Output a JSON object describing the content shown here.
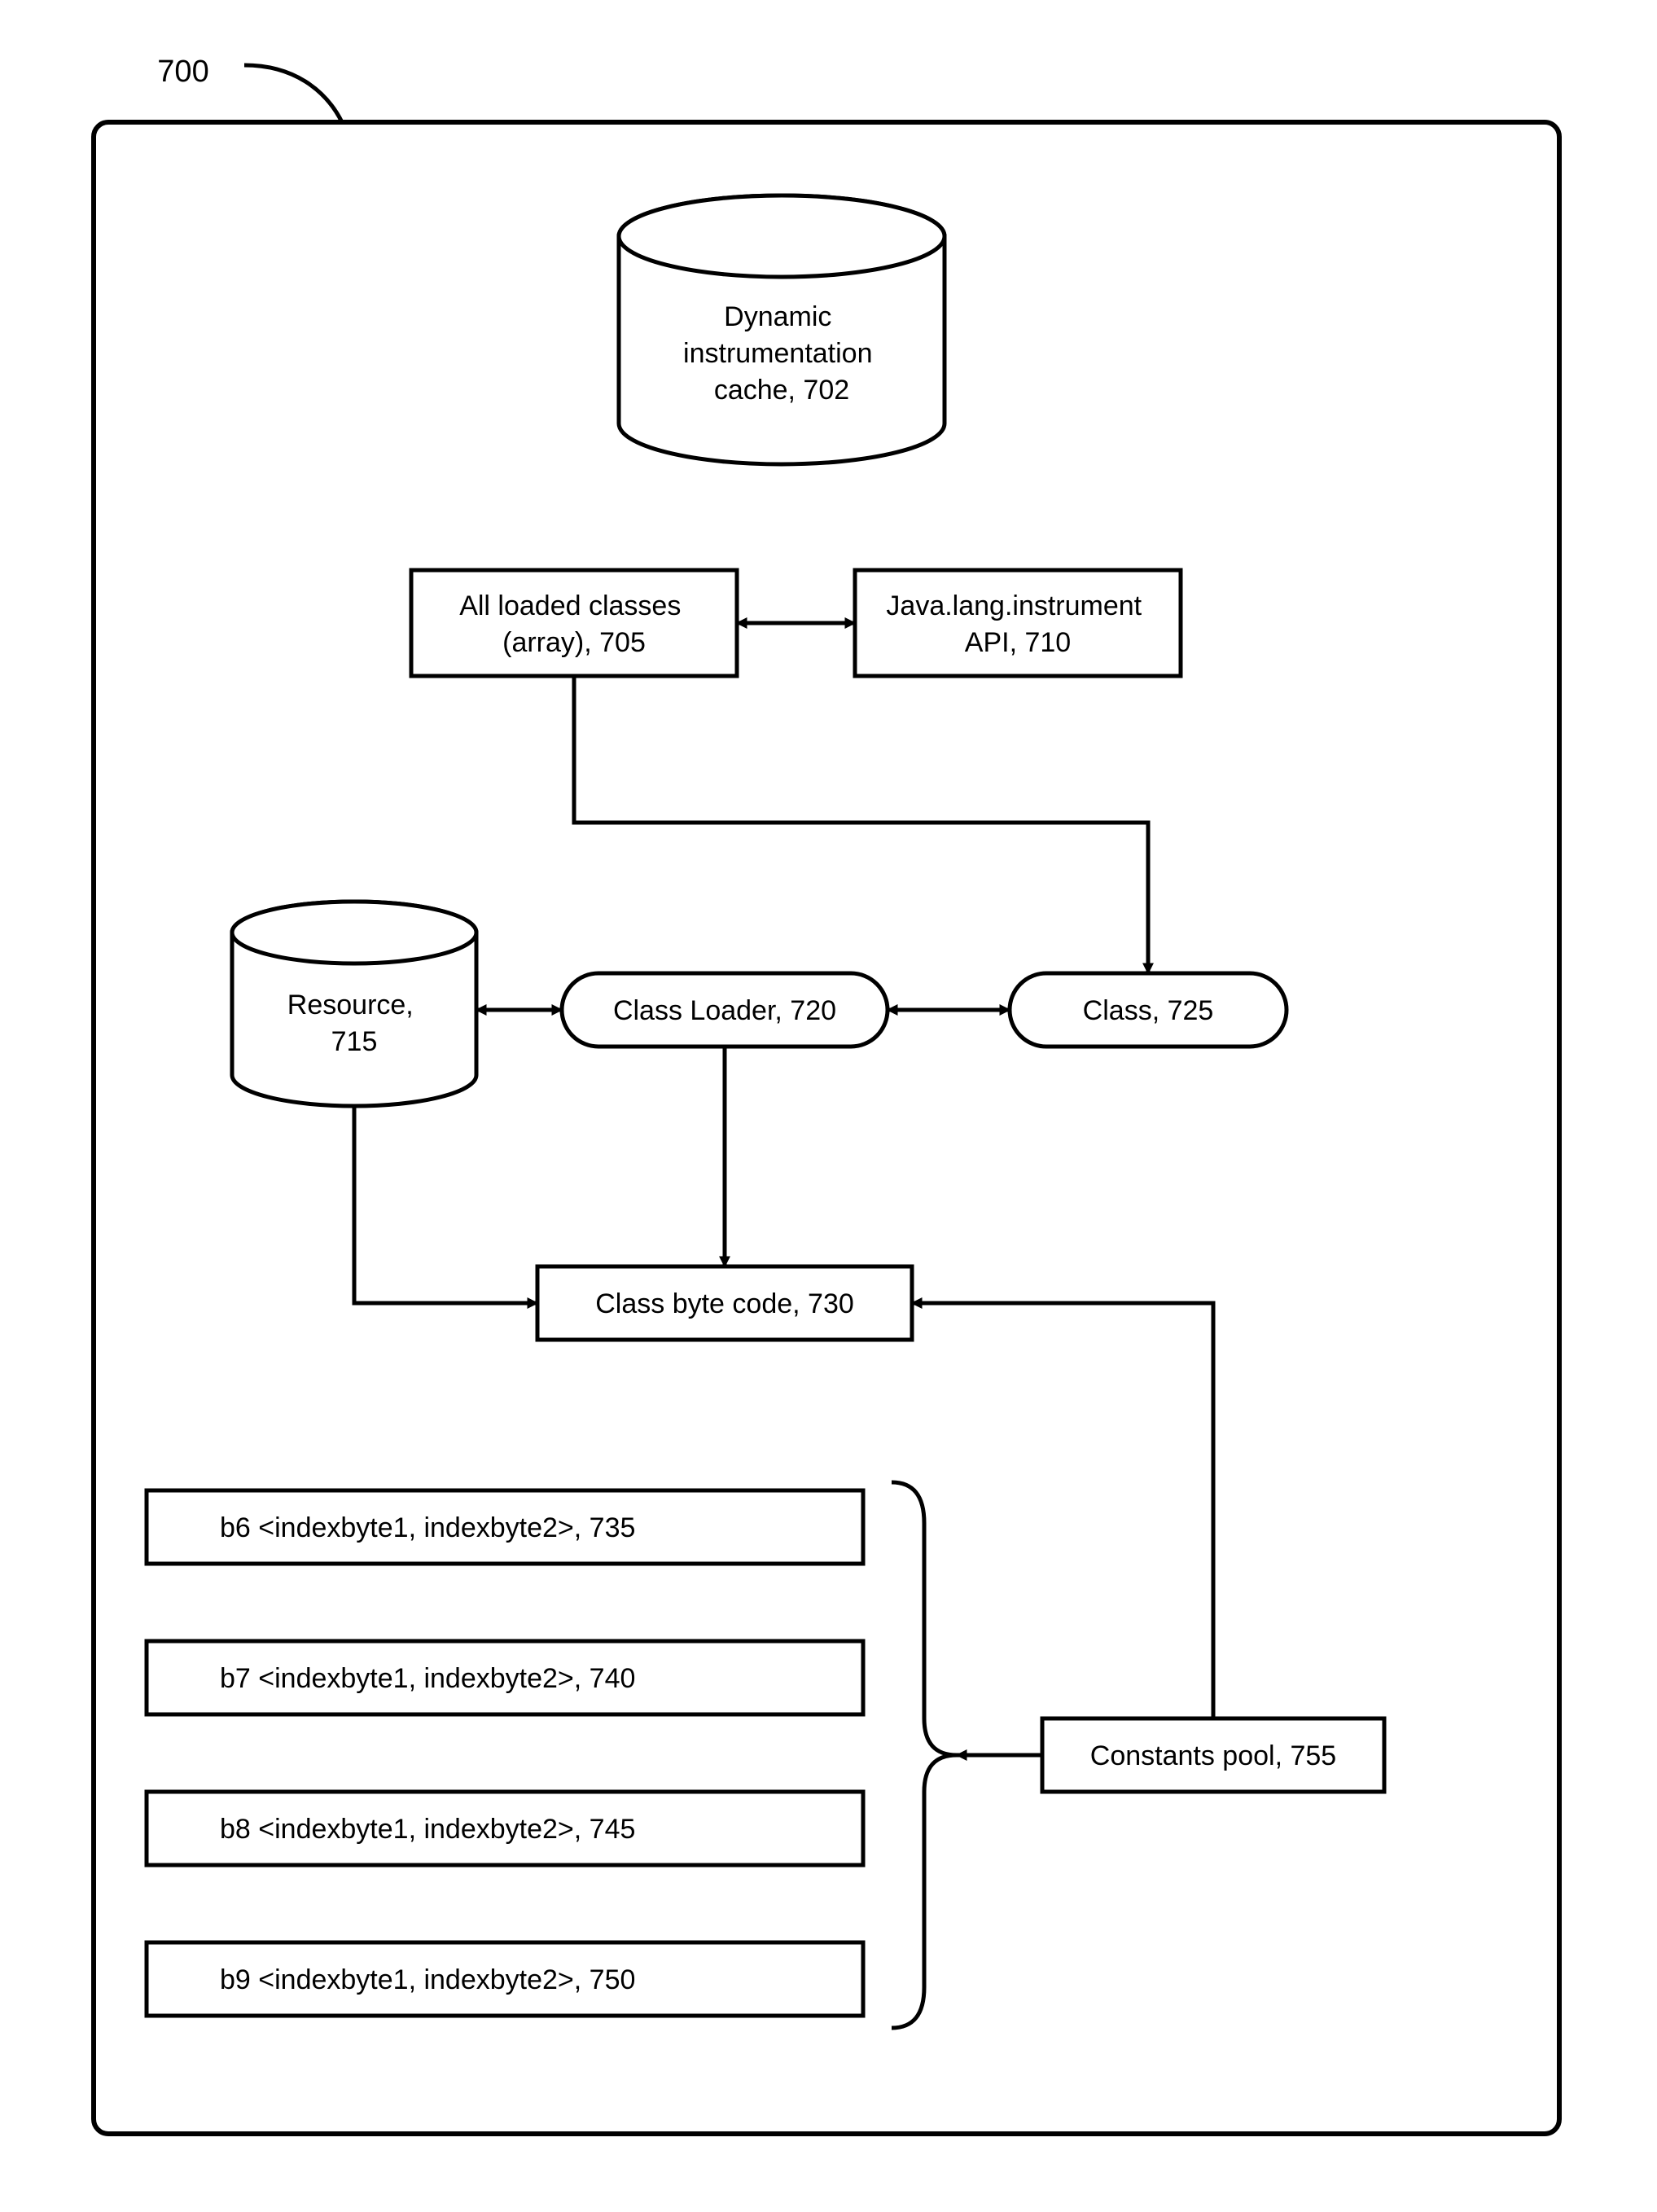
{
  "figure_label": "700",
  "nodes": {
    "cache": {
      "l1": "Dynamic",
      "l2": "instrumentation",
      "l3": "cache, 702"
    },
    "allLoaded": {
      "l1": "All loaded classes",
      "l2": "(array), 705"
    },
    "instrApi": {
      "l1": "Java.lang.instrument",
      "l2": "API, 710"
    },
    "resource": {
      "l1": "Resource,",
      "l2": "715"
    },
    "loader": {
      "l1": "Class Loader, 720"
    },
    "klass": {
      "l1": "Class, 725"
    },
    "bytecode": {
      "l1": "Class byte code, 730"
    },
    "op735": {
      "l1": "b6 <indexbyte1, indexbyte2>, 735"
    },
    "op740": {
      "l1": "b7 <indexbyte1, indexbyte2>, 740"
    },
    "op745": {
      "l1": "b8 <indexbyte1, indexbyte2>, 745"
    },
    "op750": {
      "l1": "b9 <indexbyte1, indexbyte2>, 750"
    },
    "constPool": {
      "l1": "Constants pool, 755"
    }
  }
}
